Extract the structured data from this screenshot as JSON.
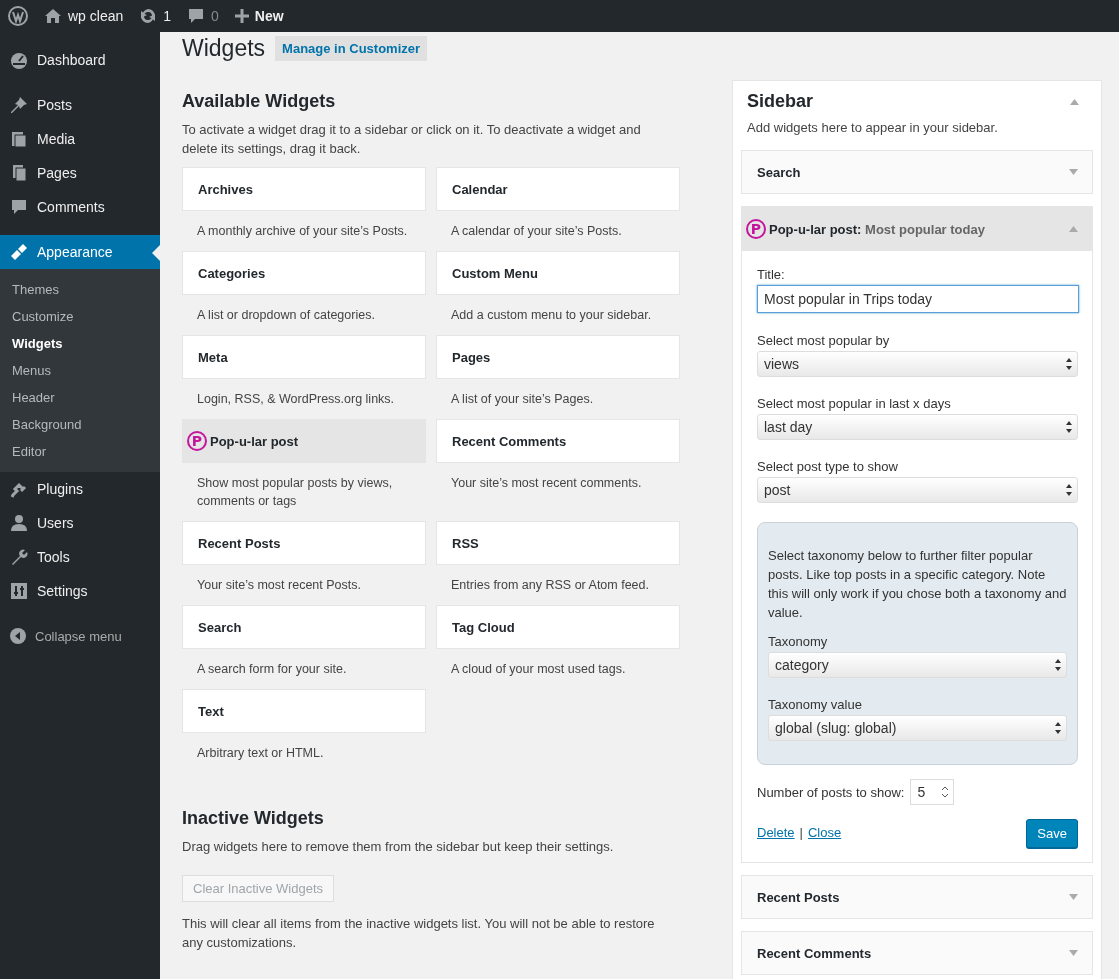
{
  "admin_bar": {
    "site": "wp clean",
    "updates": "1",
    "comments": "0",
    "new": "New"
  },
  "menu_groups": [
    [
      {
        "label": "Dashboard",
        "selected": false
      }
    ],
    [
      {
        "label": "Posts",
        "selected": false
      },
      {
        "label": "Media",
        "selected": false
      },
      {
        "label": "Pages",
        "selected": false
      },
      {
        "label": "Comments",
        "selected": false
      }
    ],
    [
      {
        "label": "Appearance",
        "selected": true,
        "children": [
          {
            "label": "Themes",
            "selected": false
          },
          {
            "label": "Customize",
            "selected": false
          },
          {
            "label": "Widgets",
            "selected": true
          },
          {
            "label": "Menus",
            "selected": false
          },
          {
            "label": "Header",
            "selected": false
          },
          {
            "label": "Background",
            "selected": false
          },
          {
            "label": "Editor",
            "selected": false
          }
        ]
      },
      {
        "label": "Plugins",
        "selected": false
      },
      {
        "label": "Users",
        "selected": false
      },
      {
        "label": "Tools",
        "selected": false
      },
      {
        "label": "Settings",
        "selected": false
      }
    ]
  ],
  "collapse_label": "Collapse menu",
  "page": {
    "title": "Widgets",
    "action": "Manage in Customizer"
  },
  "available": {
    "heading": "Available Widgets",
    "description": "To activate a widget drag it to a sidebar or click on it. To deactivate a widget and delete its settings, drag it back.",
    "widgets": [
      {
        "title": "Archives",
        "description": "A monthly archive of your site’s Posts.",
        "highlighted": false
      },
      {
        "title": "Calendar",
        "description": "A calendar of your site’s Posts.",
        "highlighted": false
      },
      {
        "title": "Categories",
        "description": "A list or dropdown of categories.",
        "highlighted": false
      },
      {
        "title": "Custom Menu",
        "description": "Add a custom menu to your sidebar.",
        "highlighted": false
      },
      {
        "title": "Meta",
        "description": "Login, RSS, & WordPress.org links.",
        "highlighted": false
      },
      {
        "title": "Pages",
        "description": "A list of your site’s Pages.",
        "highlighted": false
      },
      {
        "title": "Pop-u-lar post",
        "logo": "P",
        "description": "Show most popular posts by views, comments or tags",
        "highlighted": true
      },
      {
        "title": "Recent Comments",
        "description": "Your site’s most recent comments.",
        "highlighted": false
      },
      {
        "title": "Recent Posts",
        "description": "Your site’s most recent Posts.",
        "highlighted": false
      },
      {
        "title": "RSS",
        "description": "Entries from any RSS or Atom feed.",
        "highlighted": false
      },
      {
        "title": "Search",
        "description": "A search form for your site.",
        "highlighted": false
      },
      {
        "title": "Tag Cloud",
        "description": "A cloud of your most used tags.",
        "highlighted": false
      },
      {
        "title": "Text",
        "description": "Arbitrary text or HTML.",
        "highlighted": false
      }
    ]
  },
  "inactive": {
    "heading": "Inactive Widgets",
    "description": "Drag widgets here to remove them from the sidebar but keep their settings.",
    "button": {
      "label": "Clear Inactive Widgets",
      "disabled": true
    },
    "note": "This will clear all items from the inactive widgets list. You will not be able to restore any customizations."
  },
  "sidebar": {
    "title": "Sidebar",
    "expanded": true,
    "description": "Add widgets here to appear in your sidebar.",
    "widgets": [
      {
        "title": "Search",
        "expanded": false
      },
      {
        "title": "Pop-u-lar post",
        "logo": "P",
        "subtitle_separator": ":",
        "subtitle": "Most popular today",
        "expanded": true,
        "form": {
          "title_label": "Title:",
          "title_value": "Most popular in Trips today",
          "selects": [
            {
              "label": "Select most popular by",
              "value": "views"
            },
            {
              "label": "Select most popular in last x days",
              "value": "last day"
            },
            {
              "label": "Select post type to show",
              "value": "post"
            }
          ],
          "taxonomy": {
            "text": "Select taxonomy below to further filter popular posts. Like top posts in a specific category. Note this will only work if you chose both a taxonomy and value.",
            "selects": [
              {
                "label": "Taxonomy",
                "value": "category"
              },
              {
                "label": "Taxonomy value",
                "value": "global (slug: global)"
              }
            ]
          },
          "number_label": "Number of posts to show:",
          "number_value": "5",
          "delete": "Delete",
          "separator": "|",
          "close": "Close",
          "save": "Save"
        }
      },
      {
        "title": "Recent Posts",
        "expanded": false
      },
      {
        "title": "Recent Comments",
        "expanded": false
      }
    ]
  }
}
